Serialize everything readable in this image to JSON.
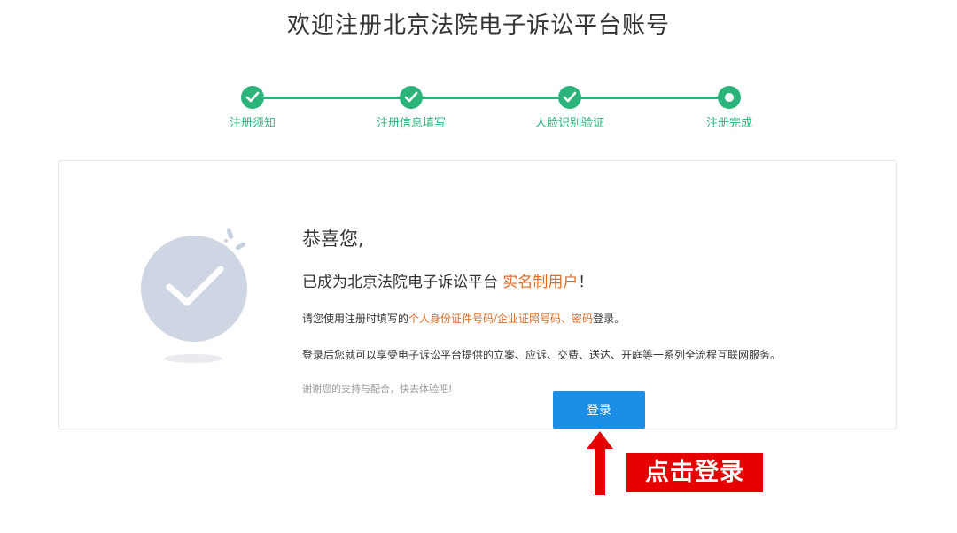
{
  "page": {
    "title": "欢迎注册北京法院电子诉讼平台账号"
  },
  "steps": [
    {
      "label": "注册须知",
      "status": "done"
    },
    {
      "label": "注册信息填写",
      "status": "done"
    },
    {
      "label": "人脸识别验证",
      "status": "done"
    },
    {
      "label": "注册完成",
      "status": "current"
    }
  ],
  "result": {
    "greeting": "恭喜您,",
    "line2_prefix": "已成为北京法院电子诉讼平台 ",
    "line2_highlight": "实名制用户",
    "line2_suffix": "！",
    "line3_prefix": "请您使用注册时填写的",
    "line3_highlight": "个人身份证件号码/企业证照号码、密码",
    "line3_suffix": "登录。",
    "line4": "登录后您就可以享受电子诉讼平台提供的立案、应诉、交费、送达、开庭等一系列全流程互联网服务。",
    "line5": "谢谢您的支持与配合，快去体验吧!",
    "login_button": "登录"
  },
  "annotation": {
    "callout": "点击登录"
  },
  "colors": {
    "step_green": "#2ab47a",
    "highlight_orange": "#e06b1f",
    "button_blue": "#1b8fe6",
    "callout_red": "#e60000"
  },
  "icons": {
    "step_done": "check-icon",
    "step_current": "dot-icon",
    "success": "success-check-icon",
    "arrow": "arrow-up-icon"
  }
}
